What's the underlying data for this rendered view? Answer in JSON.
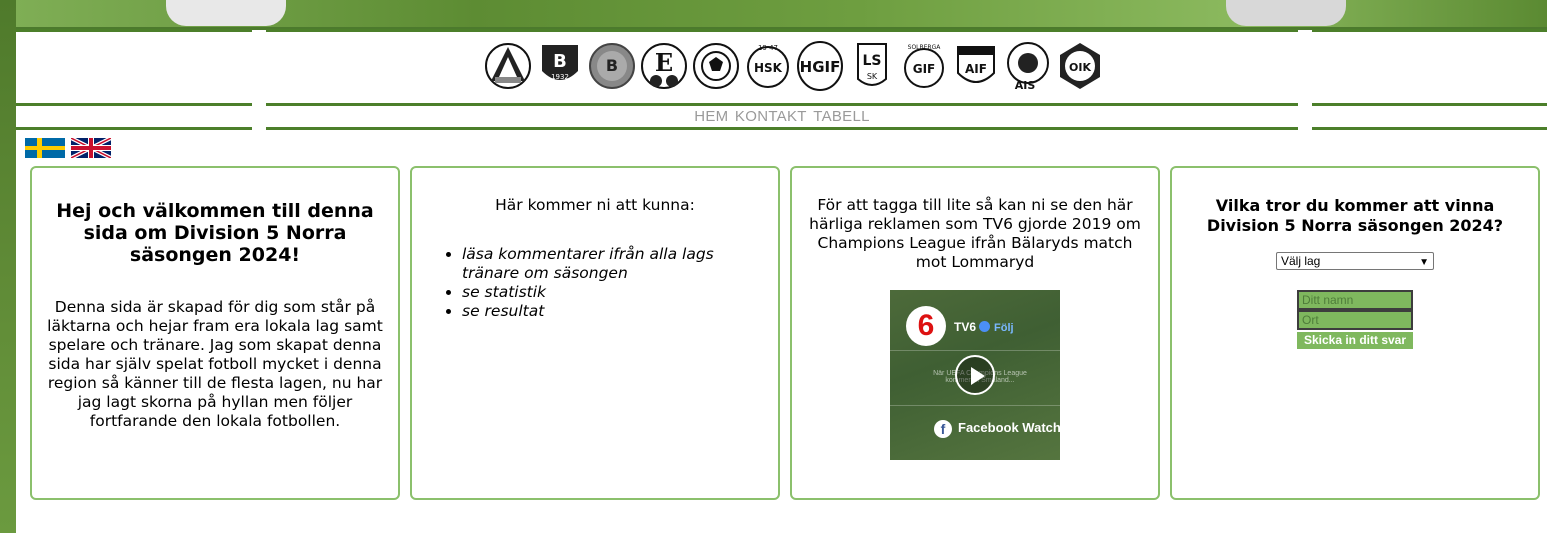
{
  "nav": {
    "items": [
      "HEM",
      "KONTAKT",
      "TABELL"
    ]
  },
  "logos": [
    "A GIF",
    "BIF 1932",
    "BIK",
    "EIF",
    "Eksjö Fotboll",
    "HSK 1947",
    "HGIF",
    "LS SK",
    "Solberga GIF",
    "Sunnanå AIF",
    "Torpa AIS",
    "OIK"
  ],
  "flags": {
    "swedish": "swedish-flag",
    "english": "uk-flag"
  },
  "card1": {
    "heading": "Hej och välkommen till denna sida om Division 5 Norra säsongen 2024!",
    "body": "Denna sida är skapad för dig som står på läktarna och hejar fram era lokala lag samt spelare och tränare. Jag som skapat denna sida har själv spelat fotboll mycket i denna region så känner till de flesta lagen, nu har jag lagt skorna på hyllan men följer fortfarande den lokala fotbollen."
  },
  "card2": {
    "intro": "Här kommer ni att kunna:",
    "items": [
      "läsa kommentarer ifrån alla lags tränare om säsongen",
      "se statistik",
      "se resultat"
    ]
  },
  "card3": {
    "text": "För att tagga till lite så kan ni se den här härliga reklamen som TV6 gjorde 2019 om Champions League ifrån Bälaryds match mot Lommaryd",
    "video": {
      "channel": "TV6",
      "follow": "Följ",
      "caption": "När UEFA Champions League kommer till Småland...",
      "platform": "Facebook Watch"
    }
  },
  "card4": {
    "title": "Vilka tror du kommer att vinna Division 5 Norra säsongen 2024?",
    "select_value": "Välj lag",
    "name_placeholder": "Ditt namn",
    "place_placeholder": "Ort",
    "submit_label": "Skicka in ditt svar"
  },
  "colors": {
    "accent_green": "#4c7f2a",
    "card_border": "#8bc06c",
    "field_green": "#7fb85e",
    "nav_gray": "#9a9a9a"
  }
}
